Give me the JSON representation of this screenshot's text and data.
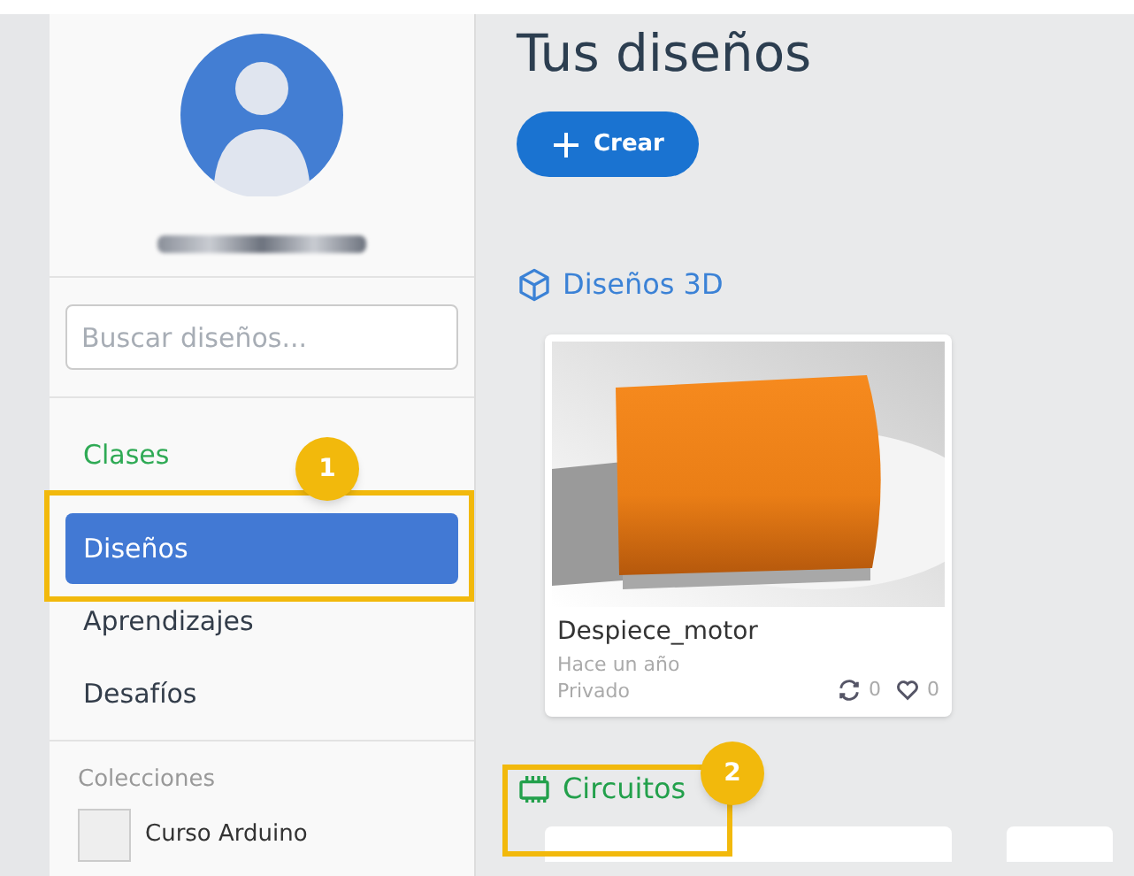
{
  "sidebar": {
    "search": {
      "placeholder": "Buscar diseños..."
    },
    "classes_link": "Clases",
    "items": [
      {
        "label": "Diseños",
        "selected": true
      },
      {
        "label": "Aprendizajes",
        "selected": false
      },
      {
        "label": "Desafíos",
        "selected": false
      }
    ],
    "collections": {
      "title": "Colecciones",
      "items": [
        {
          "label": "Curso Arduino"
        }
      ]
    }
  },
  "main": {
    "title": "Tus diseños",
    "create_button": "Crear",
    "sections": [
      {
        "kind": "models",
        "title": "Diseños 3D",
        "designs": [
          {
            "name": "Despiece_motor",
            "time": "Hace un año",
            "privacy": "Privado",
            "remixes": "0",
            "likes": "0"
          }
        ]
      },
      {
        "kind": "circuits",
        "title": "Circuitos"
      }
    ]
  },
  "annotations": [
    {
      "number": "1"
    },
    {
      "number": "2"
    }
  ]
}
